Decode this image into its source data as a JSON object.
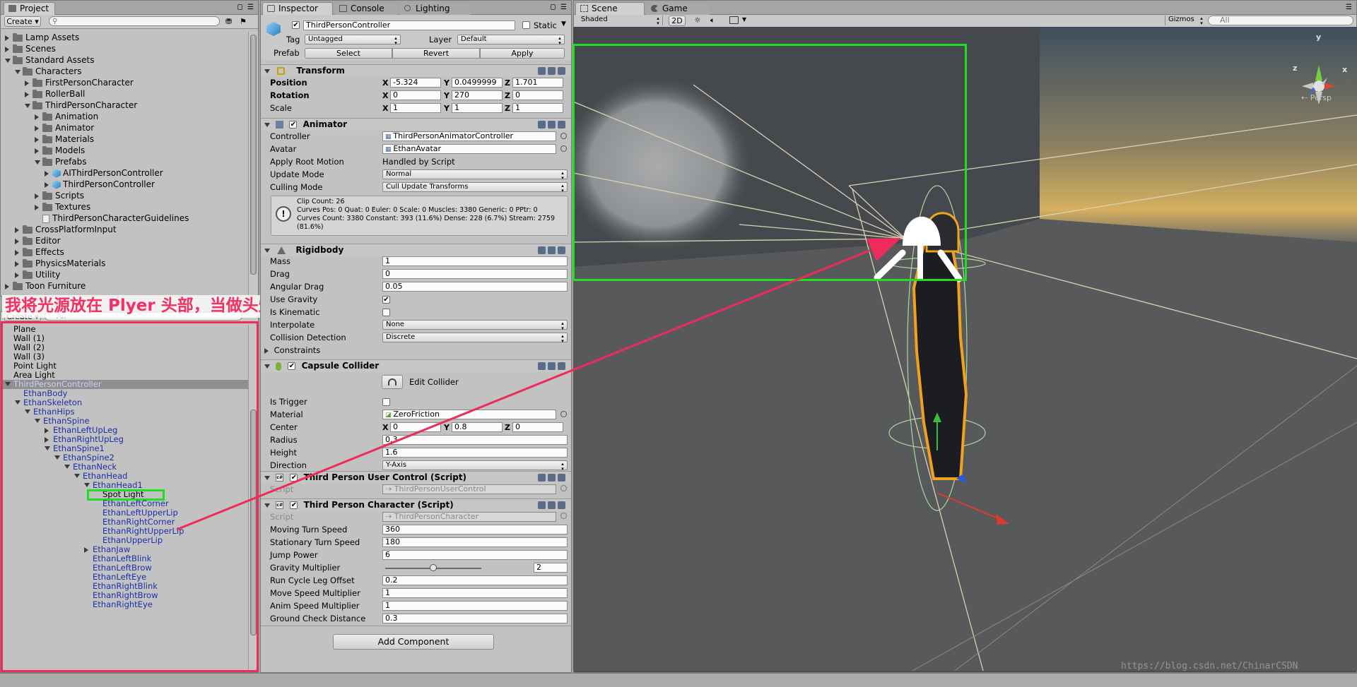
{
  "project": {
    "tab": "Project",
    "create": "Create",
    "tree": [
      {
        "label": "Lamp Assets",
        "depth": 0,
        "arrow": "right"
      },
      {
        "label": "Scenes",
        "depth": 0,
        "arrow": "right"
      },
      {
        "label": "Standard Assets",
        "depth": 0,
        "arrow": "down"
      },
      {
        "label": "Characters",
        "depth": 1,
        "arrow": "down"
      },
      {
        "label": "FirstPersonCharacter",
        "depth": 2,
        "arrow": "right"
      },
      {
        "label": "RollerBall",
        "depth": 2,
        "arrow": "right"
      },
      {
        "label": "ThirdPersonCharacter",
        "depth": 2,
        "arrow": "down"
      },
      {
        "label": "Animation",
        "depth": 3,
        "arrow": "right"
      },
      {
        "label": "Animator",
        "depth": 3,
        "arrow": "right"
      },
      {
        "label": "Materials",
        "depth": 3,
        "arrow": "right"
      },
      {
        "label": "Models",
        "depth": 3,
        "arrow": "right"
      },
      {
        "label": "Prefabs",
        "depth": 3,
        "arrow": "down"
      },
      {
        "label": "AIThirdPersonController",
        "depth": 4,
        "arrow": "right",
        "icon": "prefab"
      },
      {
        "label": "ThirdPersonController",
        "depth": 4,
        "arrow": "right",
        "icon": "prefab"
      },
      {
        "label": "Scripts",
        "depth": 3,
        "arrow": "right"
      },
      {
        "label": "Textures",
        "depth": 3,
        "arrow": "right"
      },
      {
        "label": "ThirdPersonCharacterGuidelines",
        "depth": 3,
        "arrow": "none",
        "icon": "file"
      },
      {
        "label": "CrossPlatformInput",
        "depth": 1,
        "arrow": "right"
      },
      {
        "label": "Editor",
        "depth": 1,
        "arrow": "right"
      },
      {
        "label": "Effects",
        "depth": 1,
        "arrow": "right"
      },
      {
        "label": "PhysicsMaterials",
        "depth": 1,
        "arrow": "right"
      },
      {
        "label": "Utility",
        "depth": 1,
        "arrow": "right"
      },
      {
        "label": "Toon Furniture",
        "depth": 0,
        "arrow": "right"
      }
    ]
  },
  "annotation": {
    "caption": "我将光源放在 Plyer 头部，当做头灯"
  },
  "hierarchy": {
    "create": "Create",
    "search": "All",
    "items": [
      {
        "label": "Plane",
        "indent": 0,
        "arrow": "none",
        "blue": false
      },
      {
        "label": "Wall (1)",
        "indent": 0,
        "arrow": "none",
        "blue": false
      },
      {
        "label": "Wall (2)",
        "indent": 0,
        "arrow": "none",
        "blue": false
      },
      {
        "label": "Wall (3)",
        "indent": 0,
        "arrow": "none",
        "blue": false
      },
      {
        "label": "Point Light",
        "indent": 0,
        "arrow": "none",
        "blue": false
      },
      {
        "label": "Area Light",
        "indent": 0,
        "arrow": "none",
        "blue": false
      },
      {
        "label": "ThirdPersonController",
        "indent": 0,
        "arrow": "down",
        "blue": true,
        "selected": true
      },
      {
        "label": "EthanBody",
        "indent": 1,
        "arrow": "none",
        "blue": true
      },
      {
        "label": "EthanSkeleton",
        "indent": 1,
        "arrow": "down",
        "blue": true
      },
      {
        "label": "EthanHips",
        "indent": 2,
        "arrow": "down",
        "blue": true
      },
      {
        "label": "EthanSpine",
        "indent": 3,
        "arrow": "down",
        "blue": true
      },
      {
        "label": "EthanLeftUpLeg",
        "indent": 4,
        "arrow": "right",
        "blue": true
      },
      {
        "label": "EthanRightUpLeg",
        "indent": 4,
        "arrow": "right",
        "blue": true
      },
      {
        "label": "EthanSpine1",
        "indent": 4,
        "arrow": "down",
        "blue": true
      },
      {
        "label": "EthanSpine2",
        "indent": 5,
        "arrow": "down",
        "blue": true
      },
      {
        "label": "EthanNeck",
        "indent": 6,
        "arrow": "down",
        "blue": true
      },
      {
        "label": "EthanHead",
        "indent": 7,
        "arrow": "down",
        "blue": true
      },
      {
        "label": "EthanHead1",
        "indent": 8,
        "arrow": "down",
        "blue": true
      },
      {
        "label": "Spot Light",
        "indent": 9,
        "arrow": "none",
        "blue": false,
        "highlight": true
      },
      {
        "label": "EthanLeftCorner",
        "indent": 9,
        "arrow": "none",
        "blue": true
      },
      {
        "label": "EthanLeftUpperLip",
        "indent": 9,
        "arrow": "none",
        "blue": true
      },
      {
        "label": "EthanRightCorner",
        "indent": 9,
        "arrow": "none",
        "blue": true
      },
      {
        "label": "EthanRightUpperLip",
        "indent": 9,
        "arrow": "none",
        "blue": true
      },
      {
        "label": "EthanUpperLip",
        "indent": 9,
        "arrow": "none",
        "blue": true
      },
      {
        "label": "EthanJaw",
        "indent": 8,
        "arrow": "right",
        "blue": true
      },
      {
        "label": "EthanLeftBlink",
        "indent": 8,
        "arrow": "none",
        "blue": true
      },
      {
        "label": "EthanLeftBrow",
        "indent": 8,
        "arrow": "none",
        "blue": true
      },
      {
        "label": "EthanLeftEye",
        "indent": 8,
        "arrow": "none",
        "blue": true
      },
      {
        "label": "EthanRightBlink",
        "indent": 8,
        "arrow": "none",
        "blue": true
      },
      {
        "label": "EthanRightBrow",
        "indent": 8,
        "arrow": "none",
        "blue": true
      },
      {
        "label": "EthanRightEye",
        "indent": 8,
        "arrow": "none",
        "blue": true
      }
    ]
  },
  "inspector": {
    "tabs": [
      "Inspector",
      "Console",
      "Lighting"
    ],
    "object_name": "ThirdPersonController",
    "static_label": "Static",
    "tag_label": "Tag",
    "tag_value": "Untagged",
    "layer_label": "Layer",
    "layer_value": "Default",
    "prefab_label": "Prefab",
    "prefab_buttons": [
      "Select",
      "Revert",
      "Apply"
    ],
    "transform": {
      "title": "Transform",
      "position_label": "Position",
      "position": [
        "-5.324",
        "0.0499999",
        "1.701"
      ],
      "rotation_label": "Rotation",
      "rotation": [
        "0",
        "270",
        "0"
      ],
      "scale_label": "Scale",
      "scale": [
        "1",
        "1",
        "1"
      ]
    },
    "animator": {
      "title": "Animator",
      "rows": [
        {
          "label": "Controller",
          "value": "ThirdPersonAnimatorController",
          "kind": "ref"
        },
        {
          "label": "Avatar",
          "value": "EthanAvatar",
          "kind": "ref"
        },
        {
          "label": "Apply Root Motion",
          "value": "Handled by Script",
          "kind": "text"
        },
        {
          "label": "Update Mode",
          "value": "Normal",
          "kind": "dropdown"
        },
        {
          "label": "Culling Mode",
          "value": "Cull Update Transforms",
          "kind": "dropdown"
        }
      ],
      "info": "Clip Count: 26\nCurves Pos: 0 Quat: 0 Euler: 0 Scale: 0 Muscles: 3380 Generic: 0 PPtr: 0\nCurves Count: 3380 Constant: 393 (11.6%) Dense: 228 (6.7%) Stream: 2759 (81.6%)"
    },
    "rigidbody": {
      "title": "Rigidbody",
      "rows": [
        {
          "label": "Mass",
          "value": "1",
          "kind": "field"
        },
        {
          "label": "Drag",
          "value": "0",
          "kind": "field"
        },
        {
          "label": "Angular Drag",
          "value": "0.05",
          "kind": "field"
        },
        {
          "label": "Use Gravity",
          "value": "✔",
          "kind": "check"
        },
        {
          "label": "Is Kinematic",
          "value": "",
          "kind": "check"
        },
        {
          "label": "Interpolate",
          "value": "None",
          "kind": "dropdown"
        },
        {
          "label": "Collision Detection",
          "value": "Discrete",
          "kind": "dropdown"
        }
      ],
      "constraints": "Constraints"
    },
    "capsule": {
      "title": "Capsule Collider",
      "edit_collider": "Edit Collider",
      "is_trigger": "Is Trigger",
      "material_label": "Material",
      "material": "ZeroFriction",
      "center_label": "Center",
      "center": [
        "0",
        "0.8",
        "0"
      ],
      "radius_label": "Radius",
      "radius": "0.3",
      "height_label": "Height",
      "height": "1.6",
      "direction_label": "Direction",
      "direction": "Y-Axis"
    },
    "user_control": {
      "title": "Third Person User Control (Script)",
      "script_label": "Script",
      "script": "ThirdPersonUserControl"
    },
    "character": {
      "title": "Third Person Character (Script)",
      "script_label": "Script",
      "script": "ThirdPersonCharacter",
      "rows": [
        {
          "label": "Moving Turn Speed",
          "value": "360"
        },
        {
          "label": "Stationary Turn Speed",
          "value": "180"
        },
        {
          "label": "Jump Power",
          "value": "6"
        },
        {
          "label": "Gravity Multiplier",
          "value": "2",
          "slider": 0.5
        },
        {
          "label": "Run Cycle Leg Offset",
          "value": "0.2"
        },
        {
          "label": "Move Speed Multiplier",
          "value": "1"
        },
        {
          "label": "Anim Speed Multiplier",
          "value": "1"
        },
        {
          "label": "Ground Check Distance",
          "value": "0.3"
        }
      ]
    },
    "add_component": "Add Component"
  },
  "scene": {
    "tabs": [
      "Scene",
      "Game"
    ],
    "shading": "Shaded",
    "mode_2d": "2D",
    "gizmos": "Gizmos",
    "search": "All",
    "persp": "Persp",
    "axes": {
      "x": "x",
      "y": "y",
      "z": "z"
    },
    "watermark": "https://blog.csdn.net/ChinarCSDN"
  },
  "colors": {
    "annotation_red": "#ee2b5a",
    "highlight_green": "#22dd22",
    "caption_red": "#f32f63"
  }
}
